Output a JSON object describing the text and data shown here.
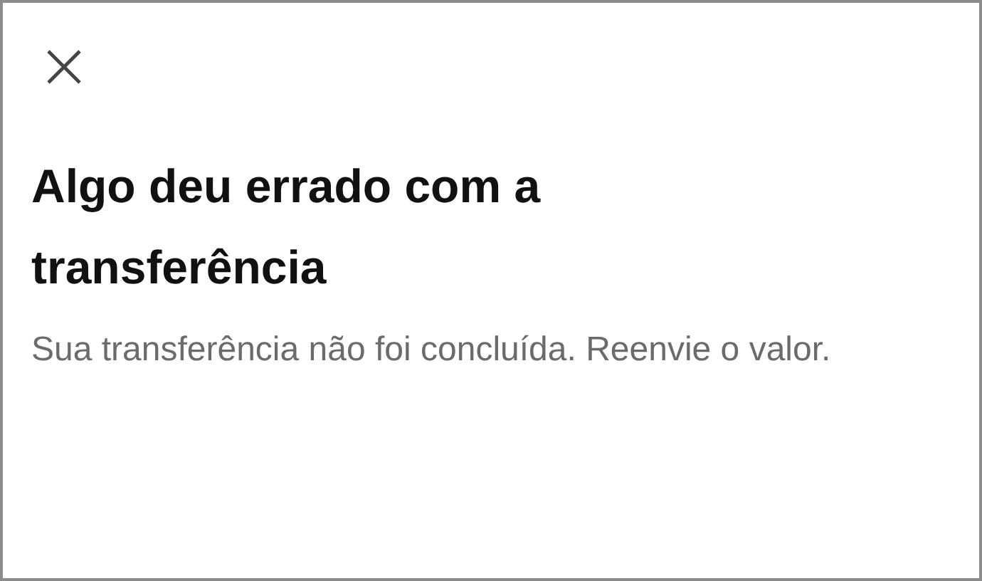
{
  "dialog": {
    "title": "Algo deu errado com a transferência",
    "message": "Sua transferência não foi concluída. Reenvie o valor."
  }
}
